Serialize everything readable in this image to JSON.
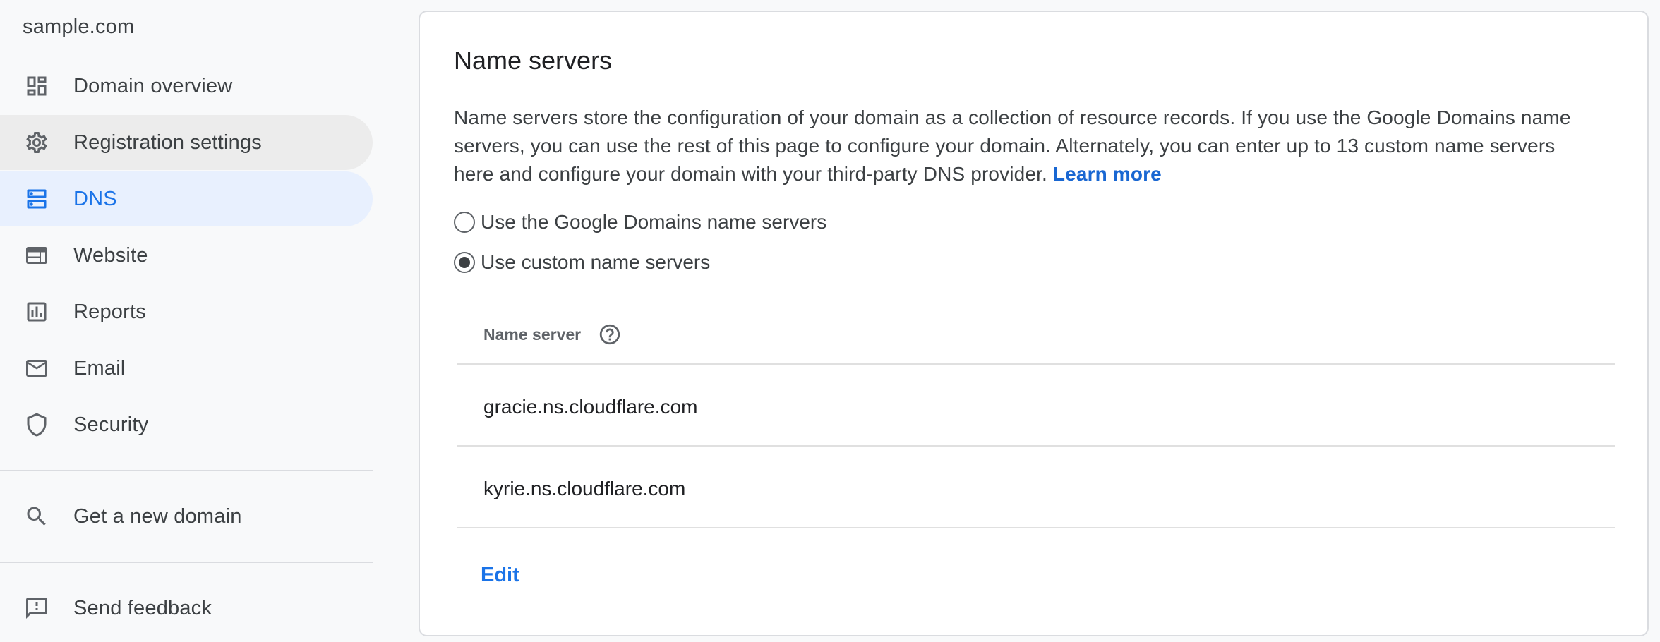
{
  "sidebar": {
    "domain": "sample.com",
    "items": [
      {
        "label": "Domain overview",
        "icon": "dashboard-icon"
      },
      {
        "label": "Registration settings",
        "icon": "gear-icon"
      },
      {
        "label": "DNS",
        "icon": "dns-icon"
      },
      {
        "label": "Website",
        "icon": "web-icon"
      },
      {
        "label": "Reports",
        "icon": "bar-chart-icon"
      },
      {
        "label": "Email",
        "icon": "mail-icon"
      },
      {
        "label": "Security",
        "icon": "shield-icon"
      }
    ],
    "get_domain": {
      "label": "Get a new domain",
      "icon": "search-icon"
    },
    "feedback": {
      "label": "Send feedback",
      "icon": "feedback-icon"
    },
    "active_item": "DNS",
    "hovered_item": "Registration settings"
  },
  "card": {
    "title": "Name servers",
    "description": "Name servers store the configuration of your domain as a collection of resource records. If you use the Google Domains name servers, you can use the rest of this page to configure your domain. Alternately, you can enter up to 13 custom name servers here and configure your domain with your third-party DNS provider.",
    "learn_more": "Learn more",
    "options": [
      {
        "label": "Use the Google Domains name servers",
        "selected": false
      },
      {
        "label": "Use custom name servers",
        "selected": true
      }
    ],
    "table_header": "Name server",
    "name_servers": [
      "gracie.ns.cloudflare.com",
      "kyrie.ns.cloudflare.com"
    ],
    "edit_label": "Edit"
  },
  "colors": {
    "accent": "#1a73e8",
    "active_bg": "#e8f0fe",
    "hover_bg": "#ececec",
    "page_bg": "#f8f9fa"
  }
}
